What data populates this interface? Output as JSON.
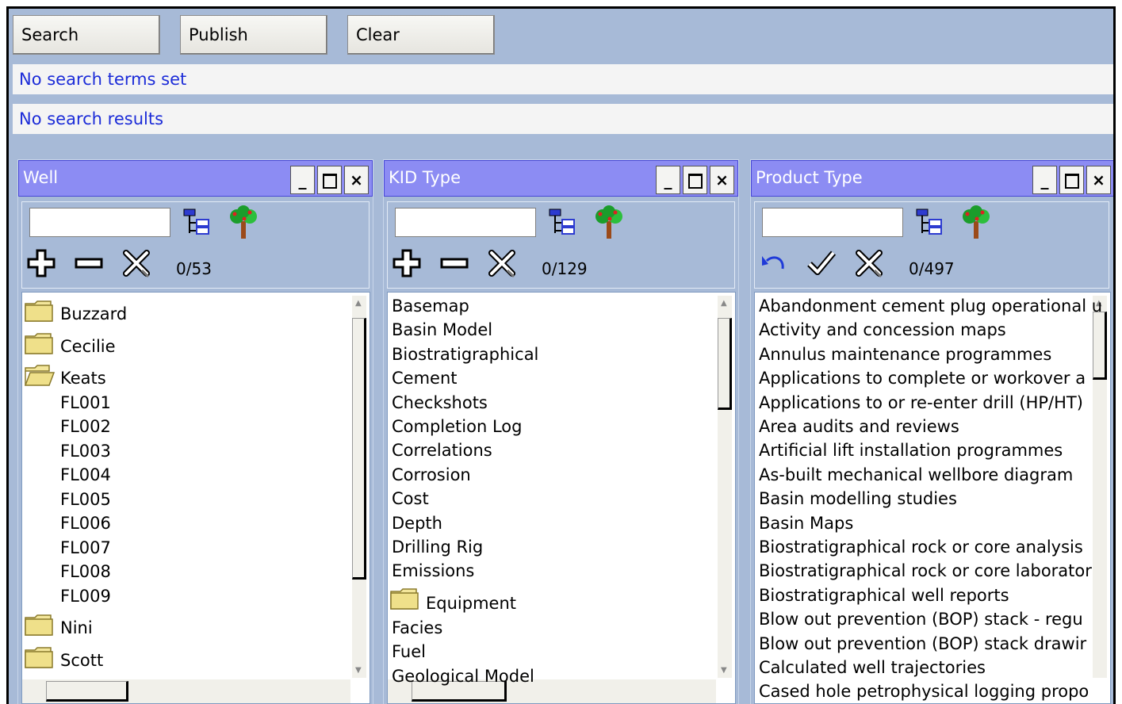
{
  "toolbar": {
    "search_label": "Search",
    "publish_label": "Publish",
    "clear_label": "Clear"
  },
  "status": {
    "search_terms": "No search terms set",
    "search_results": "No search results"
  },
  "panels": [
    {
      "title": "Well",
      "count": "0/53",
      "items": [
        {
          "label": "Buzzard",
          "kind": "folder"
        },
        {
          "label": "Cecilie",
          "kind": "folder"
        },
        {
          "label": "Keats",
          "kind": "folder-open"
        },
        {
          "label": "FL001",
          "kind": "child"
        },
        {
          "label": "FL002",
          "kind": "child"
        },
        {
          "label": "FL003",
          "kind": "child"
        },
        {
          "label": "FL004",
          "kind": "child"
        },
        {
          "label": "FL005",
          "kind": "child"
        },
        {
          "label": "FL006",
          "kind": "child"
        },
        {
          "label": "FL007",
          "kind": "child"
        },
        {
          "label": "FL008",
          "kind": "child"
        },
        {
          "label": "FL009",
          "kind": "child"
        },
        {
          "label": "Nini",
          "kind": "folder"
        },
        {
          "label": "Scott",
          "kind": "folder"
        }
      ]
    },
    {
      "title": "KID Type",
      "count": "0/129",
      "items": [
        {
          "label": "Basemap",
          "kind": "text"
        },
        {
          "label": "Basin Model",
          "kind": "text"
        },
        {
          "label": "Biostratigraphical",
          "kind": "text"
        },
        {
          "label": "Cement",
          "kind": "text"
        },
        {
          "label": "Checkshots",
          "kind": "text"
        },
        {
          "label": "Completion Log",
          "kind": "text"
        },
        {
          "label": "Correlations",
          "kind": "text"
        },
        {
          "label": "Corrosion",
          "kind": "text"
        },
        {
          "label": "Cost",
          "kind": "text"
        },
        {
          "label": "Depth",
          "kind": "text"
        },
        {
          "label": "Drilling Rig",
          "kind": "text"
        },
        {
          "label": "Emissions",
          "kind": "text"
        },
        {
          "label": "Equipment",
          "kind": "folder"
        },
        {
          "label": "Facies",
          "kind": "text"
        },
        {
          "label": "Fuel",
          "kind": "text"
        },
        {
          "label": "Geological Model",
          "kind": "text"
        }
      ]
    },
    {
      "title": "Product Type",
      "count": "0/497",
      "items": [
        {
          "label": "Abandonment cement plug operational u",
          "kind": "text"
        },
        {
          "label": "Activity and concession maps",
          "kind": "text"
        },
        {
          "label": "Annulus maintenance programmes",
          "kind": "text"
        },
        {
          "label": "Applications to complete or workover a",
          "kind": "text"
        },
        {
          "label": "Applications to or re-enter drill (HP/HT)",
          "kind": "text"
        },
        {
          "label": "Area audits and reviews",
          "kind": "text"
        },
        {
          "label": "Artificial lift installation programmes",
          "kind": "text"
        },
        {
          "label": "As-built mechanical wellbore diagram",
          "kind": "text"
        },
        {
          "label": "Basin modelling studies",
          "kind": "text"
        },
        {
          "label": "Basin Maps",
          "kind": "text"
        },
        {
          "label": "Biostratigraphical rock or core analysis",
          "kind": "text"
        },
        {
          "label": "Biostratigraphical rock or core laborator",
          "kind": "text"
        },
        {
          "label": "Biostratigraphical well reports",
          "kind": "text"
        },
        {
          "label": "Blow out prevention (BOP) stack - regu",
          "kind": "text"
        },
        {
          "label": "Blow out prevention (BOP) stack drawir",
          "kind": "text"
        },
        {
          "label": "Calculated well trajectories",
          "kind": "text"
        },
        {
          "label": "Cased hole petrophysical logging propo",
          "kind": "text"
        }
      ]
    }
  ],
  "colors": {
    "background": "#a7bad7",
    "header": "#8c8cf3",
    "status_text": "#1c2cd8",
    "folder": "#f3e69b"
  },
  "icons": {
    "toolset_a": [
      "tree-hierarchy-icon",
      "tree-icon",
      "add-icon",
      "remove-icon",
      "clear-selection-icon"
    ],
    "toolset_b": [
      "tree-hierarchy-icon",
      "tree-icon",
      "undo-icon",
      "check-icon",
      "clear-selection-icon"
    ]
  }
}
